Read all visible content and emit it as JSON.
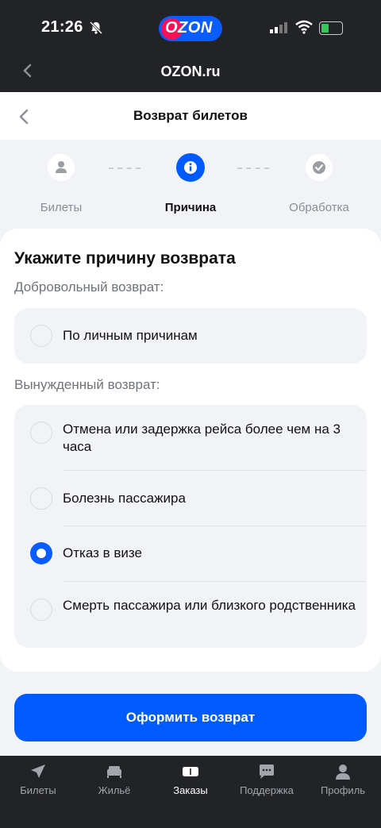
{
  "status_bar": {
    "time": "21:26"
  },
  "browser": {
    "logo_text": "OZON",
    "url": "OZON.ru"
  },
  "header": {
    "title": "Возврат билетов"
  },
  "stepper": {
    "steps": [
      {
        "label": "Билеты",
        "state": "done"
      },
      {
        "label": "Причина",
        "state": "current"
      },
      {
        "label": "Обработка",
        "state": "pending"
      }
    ]
  },
  "form": {
    "title": "Укажите причину возврата",
    "voluntary_label": "Добровольный возврат:",
    "voluntary_options": [
      {
        "label": "По личным причинам",
        "selected": false
      }
    ],
    "forced_label": "Вынужденный возврат:",
    "forced_options": [
      {
        "label": "Отмена или задержка рейса более чем на 3 часа",
        "selected": false
      },
      {
        "label": "Болезнь пассажира",
        "selected": false
      },
      {
        "label": "Отказ в визе",
        "selected": true
      },
      {
        "label": "Смерть пассажира или близкого родственника",
        "selected": false
      }
    ],
    "submit_label": "Оформить возврат"
  },
  "tabbar": {
    "items": [
      {
        "label": "Билеты",
        "icon": "plane-icon",
        "active": false
      },
      {
        "label": "Жильё",
        "icon": "bed-icon",
        "active": false
      },
      {
        "label": "Заказы",
        "icon": "ticket-icon",
        "active": true
      },
      {
        "label": "Поддержка",
        "icon": "chat-icon",
        "active": false
      },
      {
        "label": "Профиль",
        "icon": "user-icon",
        "active": false
      }
    ]
  },
  "colors": {
    "accent": "#005bff",
    "brand_pink": "#f91155",
    "dark_bar": "#222326"
  }
}
